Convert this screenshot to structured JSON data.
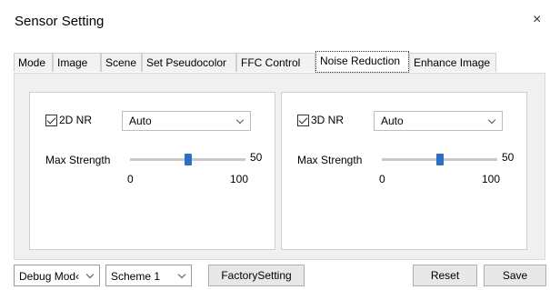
{
  "window": {
    "title": "Sensor Setting",
    "close_label": "×"
  },
  "tabs": [
    {
      "label": "Mode"
    },
    {
      "label": "Image"
    },
    {
      "label": "Scene"
    },
    {
      "label": "Set Pseudocolor"
    },
    {
      "label": "FFC Control"
    },
    {
      "label": "Noise Reduction",
      "active": true
    },
    {
      "label": "Enhance Image"
    }
  ],
  "nr2d": {
    "checkbox_label": "2D NR",
    "checked": true,
    "select_value": "Auto",
    "strength_label": "Max Strength",
    "value": "50",
    "min": "0",
    "max": "100"
  },
  "nr3d": {
    "checkbox_label": "3D NR",
    "checked": true,
    "select_value": "Auto",
    "strength_label": "Max Strength",
    "value": "50",
    "min": "0",
    "max": "100"
  },
  "bottom": {
    "debug_mode": "Debug Mod‹",
    "scheme": "Scheme 1",
    "factory_label": "FactorySetting",
    "reset_label": "Reset",
    "save_label": "Save"
  },
  "colors": {
    "accent": "#2d6fc4",
    "panel_bg": "#f0f0f0"
  }
}
